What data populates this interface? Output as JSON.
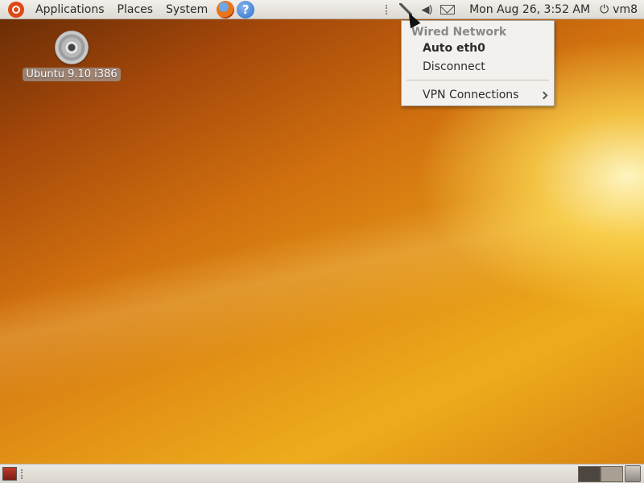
{
  "top_panel": {
    "menus": [
      {
        "label": "Applications",
        "icon": "ubuntu-logo-icon"
      },
      {
        "label": "Places"
      },
      {
        "label": "System"
      }
    ],
    "launchers": [
      {
        "icon": "firefox-icon"
      },
      {
        "icon": "help-icon",
        "glyph": "?"
      }
    ],
    "tray": {
      "icons": [
        "network-icon",
        "volume-icon",
        "mail-icon"
      ],
      "clock": "Mon Aug 26,  3:52 AM",
      "session_user": "vm8",
      "session_icon": "power-icon"
    }
  },
  "desktop": {
    "icons": [
      {
        "label": "Ubuntu 9.10 i386",
        "icon": "cd-disc-icon"
      }
    ]
  },
  "network_menu": {
    "header": "Wired Network",
    "items": [
      {
        "label": "Auto eth0",
        "active": true
      },
      {
        "label": "Disconnect"
      },
      {
        "label": "VPN Connections",
        "submenu": true
      }
    ]
  },
  "bottom_panel": {
    "workspaces": 2,
    "icons": [
      "show-desktop-icon",
      "trash-icon"
    ]
  },
  "colors": {
    "panel": "#dedad3",
    "wallpaper_dark": "#6b2d06",
    "wallpaper_light": "#eeac1c",
    "menu_bg": "#f3f1ed"
  }
}
